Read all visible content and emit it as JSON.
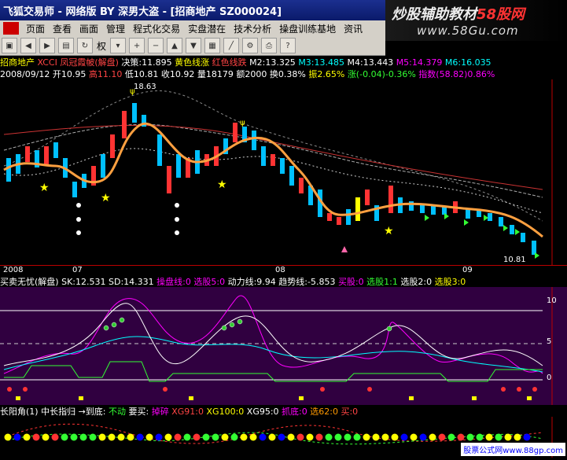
{
  "window": {
    "title": "飞狐交易师 - 网络版 BY 深男大盗 - [招商地产 SZ000024]"
  },
  "banner": {
    "line1_prefix": "炒股辅助教材",
    "line1_suffix": "58股网",
    "line2": "www.58Gu.com"
  },
  "menu": [
    "页面",
    "查看",
    "画面",
    "管理",
    "程式化交易",
    "实盘潜在",
    "技术分析",
    "操盘训练基地",
    "资讯"
  ],
  "toolbar": {
    "label": "权"
  },
  "info1": {
    "stock": "招商地产",
    "formula": "XCCI 凤冠霞帔(解盘)",
    "decision": "决策:11.895",
    "yellow": "黄色线涨",
    "red": "红色线跌",
    "m2": "M2:13.325",
    "m3": "M3:13.485",
    "m4": "M4:13.443",
    "m5": "M5:14.379",
    "m6": "M6:16.035"
  },
  "info2": {
    "date": "2008/09/12",
    "open": "开10.95",
    "high": "高11.10",
    "low": "低10.81",
    "close": "收10.92",
    "vol": "量18179",
    "amount": "额2000",
    "turnover": "换0.38%",
    "amp": "振2.65%",
    "change": "涨(-0.04)-0.36%",
    "index": "指数(58.82)0.86%"
  },
  "chart_labels": {
    "peak": "18.63",
    "low": "10.81"
  },
  "dates": [
    "2008",
    "07",
    "08",
    "09"
  ],
  "ind1": {
    "title": "买卖无忧(解盘)",
    "sk": "SK:12.531",
    "sd": "SD:14.331",
    "op": "操盘线:0",
    "x5": "选股5:0",
    "power": "动力线:9.94",
    "trend": "趋势线:-5.853",
    "buy": "买股:0",
    "s11": "选股1:1",
    "s20": "选股2:0",
    "s30": "选股3:0",
    "ticks": [
      "10",
      "5",
      "0"
    ]
  },
  "ind2": {
    "title": "长阳角(1)",
    "mid": "中长指归",
    "arrow": "→到底:",
    "stay": "不动",
    "want": "要买:",
    "fall": "掉碎",
    "x91": "XG91:0",
    "x100": "XG100:0",
    "x95": "XG95:0",
    "grab": "抓底:0",
    "s62": "选62:0",
    "buy": "买:0"
  },
  "watermark": "股票公式网www.88gp.com",
  "colors": {
    "up": "#ff3333",
    "down": "#00c0ff",
    "ma_main": "#ffa040",
    "title_bg": "#0a1a6a"
  }
}
